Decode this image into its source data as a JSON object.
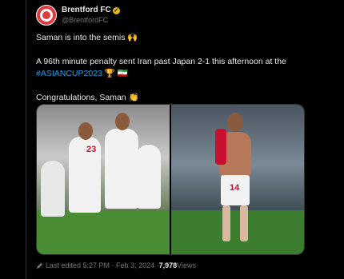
{
  "account": {
    "name": "Brentford FC",
    "handle": "@BrentfordFC"
  },
  "post": {
    "line1": "Saman is into the semis 🙌",
    "line2": "A 96th minute penalty sent Iran past Japan 2-1 this afternoon at the",
    "hashtag": "#ASIANCUP2023",
    "hashtag_suffix": " 🏆 🇮🇷",
    "line3": "Congratulations, Saman 👏"
  },
  "images": [
    {
      "alt": "Iran players celebrating on the pitch",
      "shirt_numbers": [
        "23"
      ]
    },
    {
      "alt": "Saman Ghoddos shirtless celebrating",
      "shirt_numbers": [
        "14"
      ]
    }
  ],
  "footer": {
    "edited": "Last edited 5:27 PM · Feb 3, 2024 · ",
    "views": "7,978",
    "views_label": " Views"
  },
  "colors": {
    "accent": "#1d9bf0",
    "brand": "#e03a3e",
    "verified": "#e2b719"
  },
  "icons": {
    "verified": "verified-badge-icon",
    "edit": "pencil-icon"
  }
}
